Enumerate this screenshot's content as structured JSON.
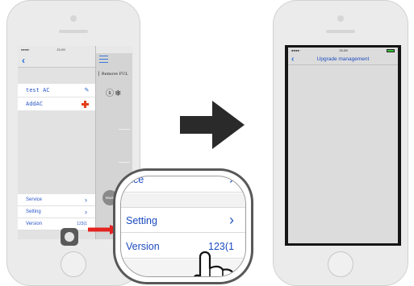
{
  "left_phone": {
    "status_time": "21:09",
    "devices": [
      {
        "name": "test AC",
        "action_icon": "pencil-icon"
      },
      {
        "name": "AddAC",
        "action_icon": "plus-icon"
      }
    ],
    "side_panel": {
      "remove_label": "Remove FUL",
      "icons": "ⓢ❄",
      "mode_label": "Mode"
    },
    "menu": [
      {
        "label": "Service",
        "value": "",
        "icon": "chevron-right-icon"
      },
      {
        "label": "Setting",
        "value": "",
        "icon": "chevron-right-icon"
      },
      {
        "label": "Version",
        "value": "123(1",
        "icon": ""
      }
    ]
  },
  "magnifier": {
    "rows": [
      {
        "label": "vice",
        "value": "",
        "icon": "chevron-right-icon"
      },
      {
        "label": "Setting",
        "value": "",
        "icon": "chevron-right-icon"
      },
      {
        "label": "Version",
        "value": "123(1",
        "icon": ""
      }
    ]
  },
  "right_phone": {
    "status_time": "21:09",
    "nav_title": "Upgrade management"
  },
  "colors": {
    "accent_blue": "#1c4bc0",
    "arrow_red": "#e42320",
    "arrow_dark": "#2a2a2a",
    "plus_orange": "#e2401c"
  }
}
